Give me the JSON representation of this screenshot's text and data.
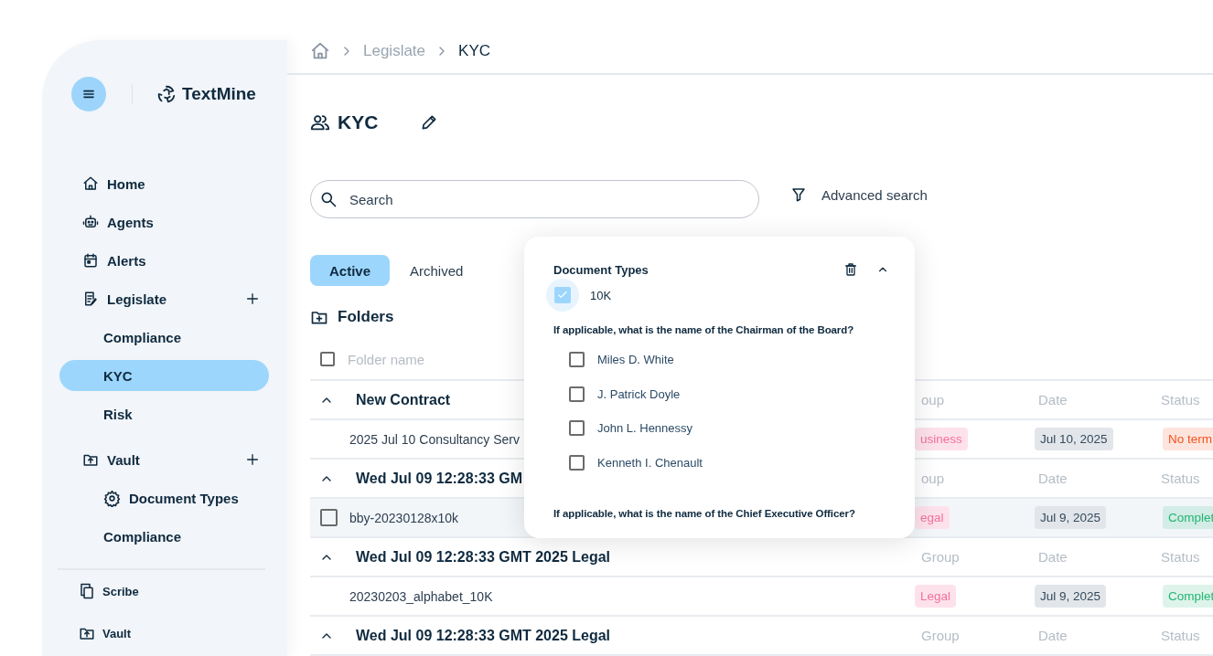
{
  "sidebar": {
    "logo": "TextMine",
    "items": [
      {
        "label": "Home",
        "selected": false
      },
      {
        "label": "Agents",
        "selected": false
      },
      {
        "label": "Alerts",
        "selected": false
      },
      {
        "label": "Legislate",
        "selected": false,
        "children": [
          {
            "label": "Compliance",
            "selected": false
          },
          {
            "label": "KYC",
            "selected": true
          },
          {
            "label": "Risk",
            "selected": false
          }
        ]
      },
      {
        "label": "Vault",
        "selected": false,
        "children": [
          {
            "label": "Document Types",
            "selected": false
          },
          {
            "label": "Compliance",
            "selected": false
          }
        ]
      }
    ],
    "footer_items": [
      {
        "label": "Scribe"
      },
      {
        "label": "Vault"
      }
    ]
  },
  "breadcrumb": [
    "Legislate",
    "KYC"
  ],
  "page": {
    "title": "KYC",
    "search": {
      "placeholder": "Search"
    },
    "advanced_search": "Advanced search",
    "tabs": [
      {
        "label": "Active",
        "selected": true
      },
      {
        "label": "Archived",
        "selected": false
      }
    ],
    "folders_heading": "Folders",
    "folder_name": {
      "placeholder": "Folder name",
      "checked": false
    },
    "groups": [
      {
        "title": "New Contract",
        "columns": [
          "oup",
          "Date",
          "Status"
        ],
        "rows": [
          {
            "name": "2025 Jul 10 Consultancy Serv",
            "highlighted": false,
            "group": "usiness",
            "date": "Jul 10, 2025",
            "status": {
              "text": "No term",
              "color": "#f4511e"
            }
          }
        ]
      },
      {
        "title": "Wed Jul 09 12:28:33 GM",
        "columns": [
          "oup",
          "Date",
          "Status"
        ],
        "rows": [
          {
            "name": "bby-20230128x10k",
            "highlighted": true,
            "checked": false,
            "group": "egal",
            "date": "Jul 9, 2025",
            "status": {
              "text": "Complet",
              "color": "#22b573"
            }
          }
        ]
      },
      {
        "title": "Wed Jul 09 12:28:33 GMT 2025 Legal",
        "columns": [
          "Group",
          "Date",
          "Status"
        ],
        "rows": [
          {
            "name": "20230203_alphabet_10K",
            "highlighted": false,
            "group": "Legal",
            "date": "Jul 9, 2025",
            "status": {
              "text": "Complet",
              "color": "#22b573"
            }
          }
        ]
      },
      {
        "title": "Wed Jul 09 12:28:33 GMT 2025 Legal",
        "columns": [
          "Group",
          "Date",
          "Status"
        ]
      }
    ]
  },
  "filter_panel": {
    "title": "Document Types",
    "options": [
      {
        "label": "10K",
        "checked": true
      }
    ],
    "questions": [
      {
        "text": "If applicable, what is the name of the Chairman of the Board?",
        "options": [
          {
            "label": "Miles D. White",
            "checked": false
          },
          {
            "label": "J. Patrick Doyle",
            "checked": false
          },
          {
            "label": "John L. Hennessy",
            "checked": false
          },
          {
            "label": "Kenneth I. Chenault",
            "checked": false
          }
        ]
      },
      {
        "text": "If applicable, what is the name of the Chief Executive Officer?"
      }
    ]
  }
}
